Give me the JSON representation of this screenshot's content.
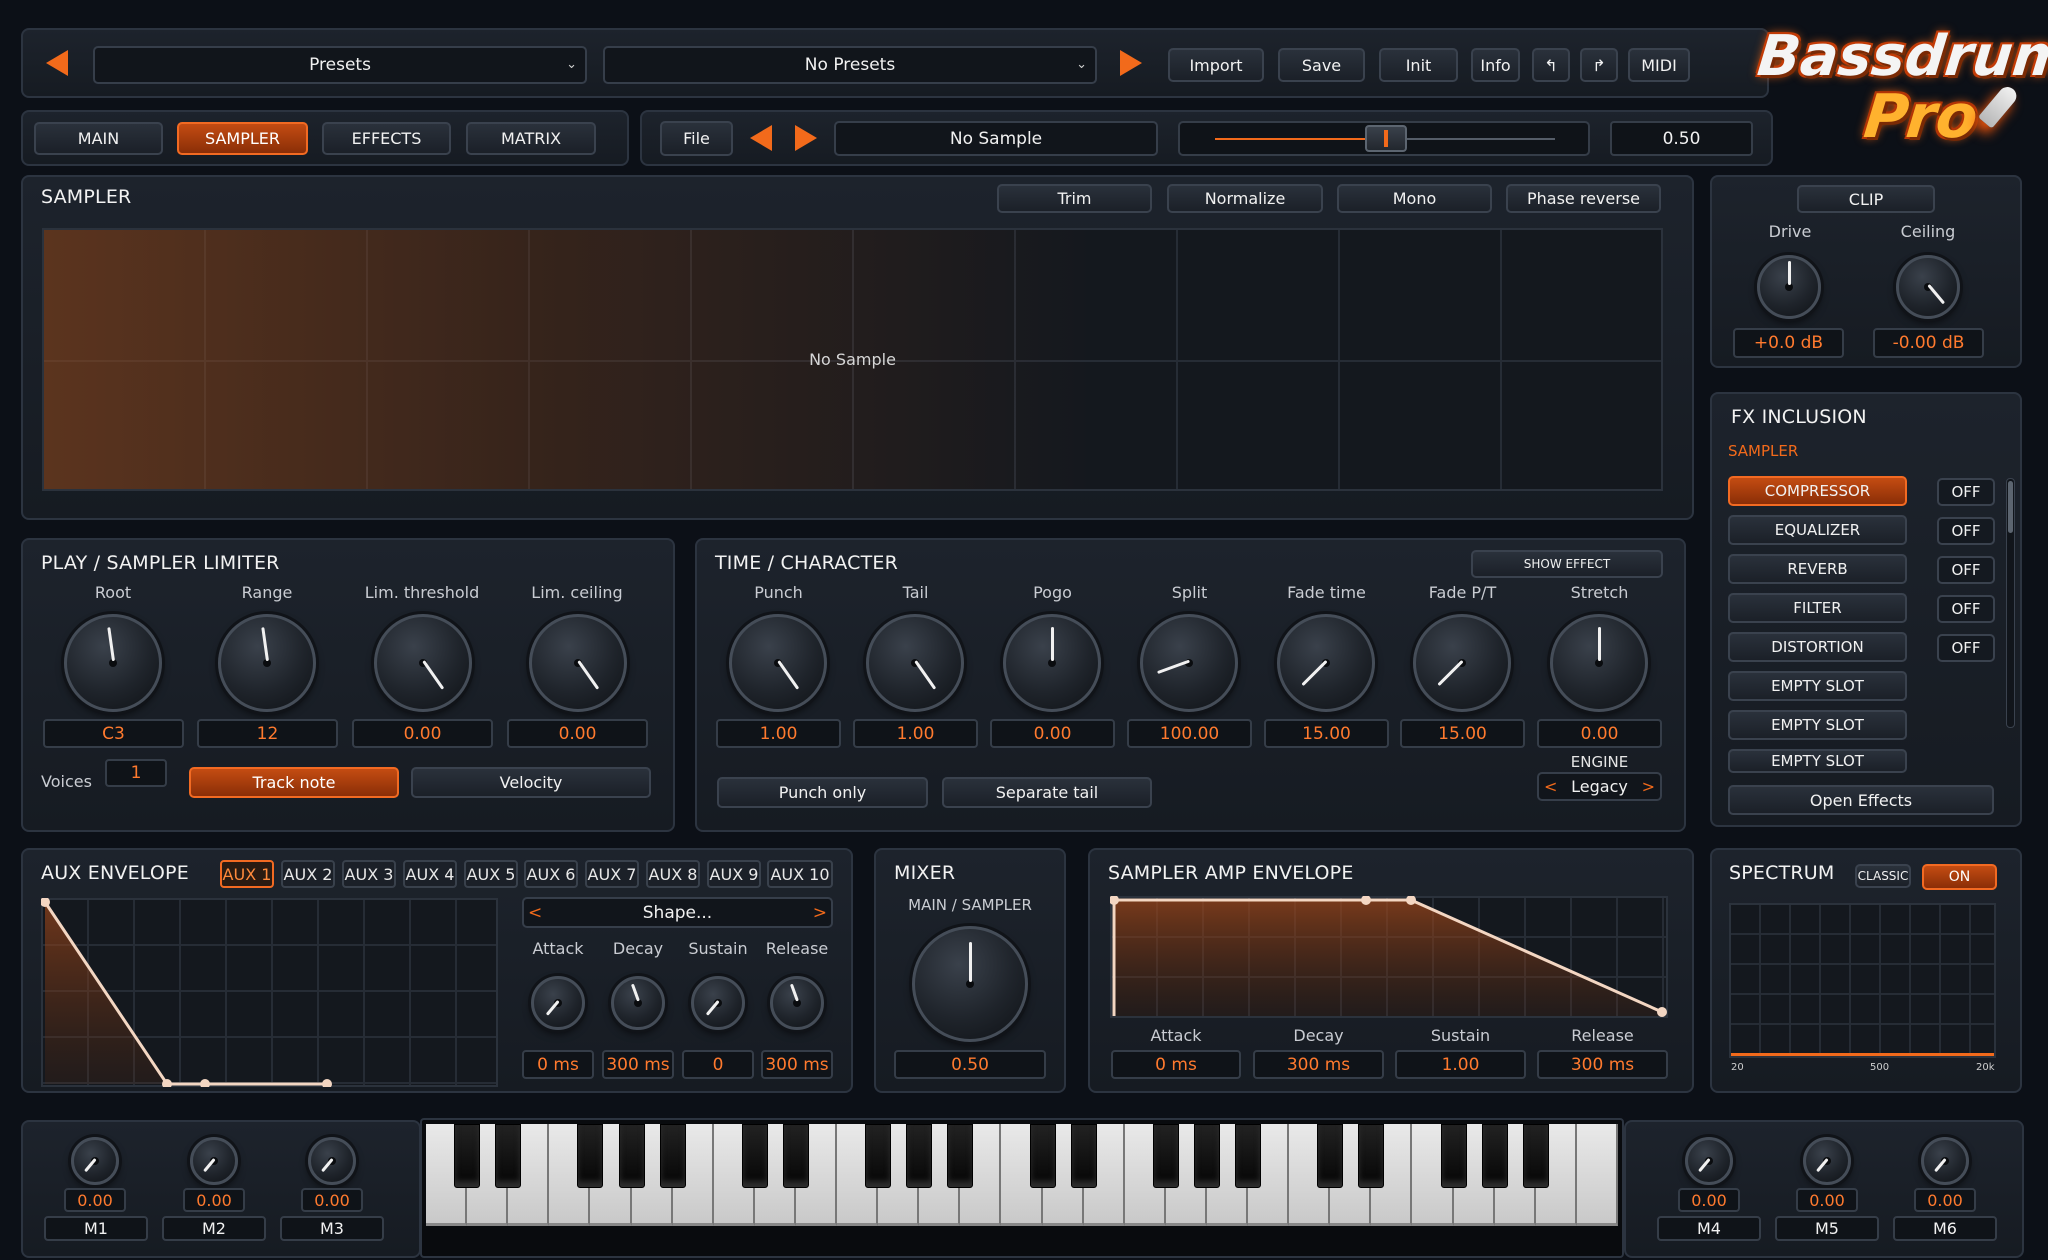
{
  "header": {
    "preset_bank": "Presets",
    "preset_name": "No Presets",
    "buttons": {
      "import": "Import",
      "save": "Save",
      "init": "Init",
      "info": "Info",
      "undo": "↰",
      "redo": "↱",
      "midi": "MIDI"
    },
    "logo_line1": "Bassdrum",
    "logo_line2": "Pro"
  },
  "tabs": {
    "main": "MAIN",
    "sampler": "SAMPLER",
    "effects": "EFFECTS",
    "matrix": "MATRIX"
  },
  "file_bar": {
    "file": "File",
    "sample_name": "No Sample",
    "value": "0.50",
    "slider_level": 0.5
  },
  "sampler": {
    "title": "SAMPLER",
    "buttons": {
      "trim": "Trim",
      "normalize": "Normalize",
      "mono": "Mono",
      "phase": "Phase reverse"
    },
    "display_text": "No Sample"
  },
  "clip": {
    "title": "CLIP",
    "drive_label": "Drive",
    "drive_value": "+0.0 dB",
    "ceiling_label": "Ceiling",
    "ceiling_value": "-0.00 dB"
  },
  "fx": {
    "title": "FX INCLUSION",
    "subtitle": "SAMPLER",
    "slots": [
      "COMPRESSOR",
      "EQUALIZER",
      "REVERB",
      "FILTER",
      "DISTORTION",
      "EMPTY SLOT",
      "EMPTY SLOT",
      "EMPTY SLOT"
    ],
    "states": [
      "OFF",
      "OFF",
      "OFF",
      "OFF",
      "OFF"
    ],
    "open": "Open Effects"
  },
  "play": {
    "title": "PLAY / SAMPLER LIMITER",
    "knobs": [
      {
        "label": "Root",
        "value": "C3"
      },
      {
        "label": "Range",
        "value": "12"
      },
      {
        "label": "Lim. threshold",
        "value": "0.00"
      },
      {
        "label": "Lim. ceiling",
        "value": "0.00"
      }
    ],
    "voices_label": "Voices",
    "voices_value": "1",
    "track_note": "Track note",
    "velocity": "Velocity"
  },
  "time": {
    "title": "TIME / CHARACTER",
    "show_effect": "SHOW EFFECT",
    "knobs": [
      {
        "label": "Punch",
        "value": "1.00"
      },
      {
        "label": "Tail",
        "value": "1.00"
      },
      {
        "label": "Pogo",
        "value": "0.00"
      },
      {
        "label": "Split",
        "value": "100.00"
      },
      {
        "label": "Fade time",
        "value": "15.00"
      },
      {
        "label": "Fade P/T",
        "value": "15.00"
      },
      {
        "label": "Stretch",
        "value": "0.00"
      }
    ],
    "punch_only": "Punch only",
    "separate_tail": "Separate tail",
    "engine_label": "ENGINE",
    "engine_value": "Legacy",
    "engine_prev": "<",
    "engine_next": ">"
  },
  "aux": {
    "title": "AUX ENVELOPE",
    "tabs": [
      "AUX 1",
      "AUX 2",
      "AUX 3",
      "AUX 4",
      "AUX 5",
      "AUX 6",
      "AUX 7",
      "AUX 8",
      "AUX 9",
      "AUX 10"
    ],
    "shape": "Shape...",
    "shape_prev": "<",
    "shape_next": ">",
    "knobs": [
      {
        "label": "Attack",
        "value": "0 ms"
      },
      {
        "label": "Decay",
        "value": "300 ms"
      },
      {
        "label": "Sustain",
        "value": "0"
      },
      {
        "label": "Release",
        "value": "300 ms"
      }
    ]
  },
  "mixer": {
    "title": "MIXER",
    "label": "MAIN / SAMPLER",
    "value": "0.50"
  },
  "amp": {
    "title": "SAMPLER AMP ENVELOPE",
    "params": [
      {
        "label": "Attack",
        "value": "0 ms"
      },
      {
        "label": "Decay",
        "value": "300 ms"
      },
      {
        "label": "Sustain",
        "value": "1.00"
      },
      {
        "label": "Release",
        "value": "300 ms"
      }
    ]
  },
  "spectrum": {
    "title": "SPECTRUM",
    "classic": "CLASSIC",
    "on": "ON",
    "ticks": [
      "20",
      "500",
      "20k"
    ]
  },
  "macros": [
    {
      "name": "M1",
      "value": "0.00"
    },
    {
      "name": "M2",
      "value": "0.00"
    },
    {
      "name": "M3",
      "value": "0.00"
    },
    {
      "name": "M4",
      "value": "0.00"
    },
    {
      "name": "M5",
      "value": "0.00"
    },
    {
      "name": "M6",
      "value": "0.00"
    }
  ],
  "colors": {
    "accent": "#f26a1b",
    "panel": "#1b2129",
    "value_text": "#ff7a2e"
  }
}
